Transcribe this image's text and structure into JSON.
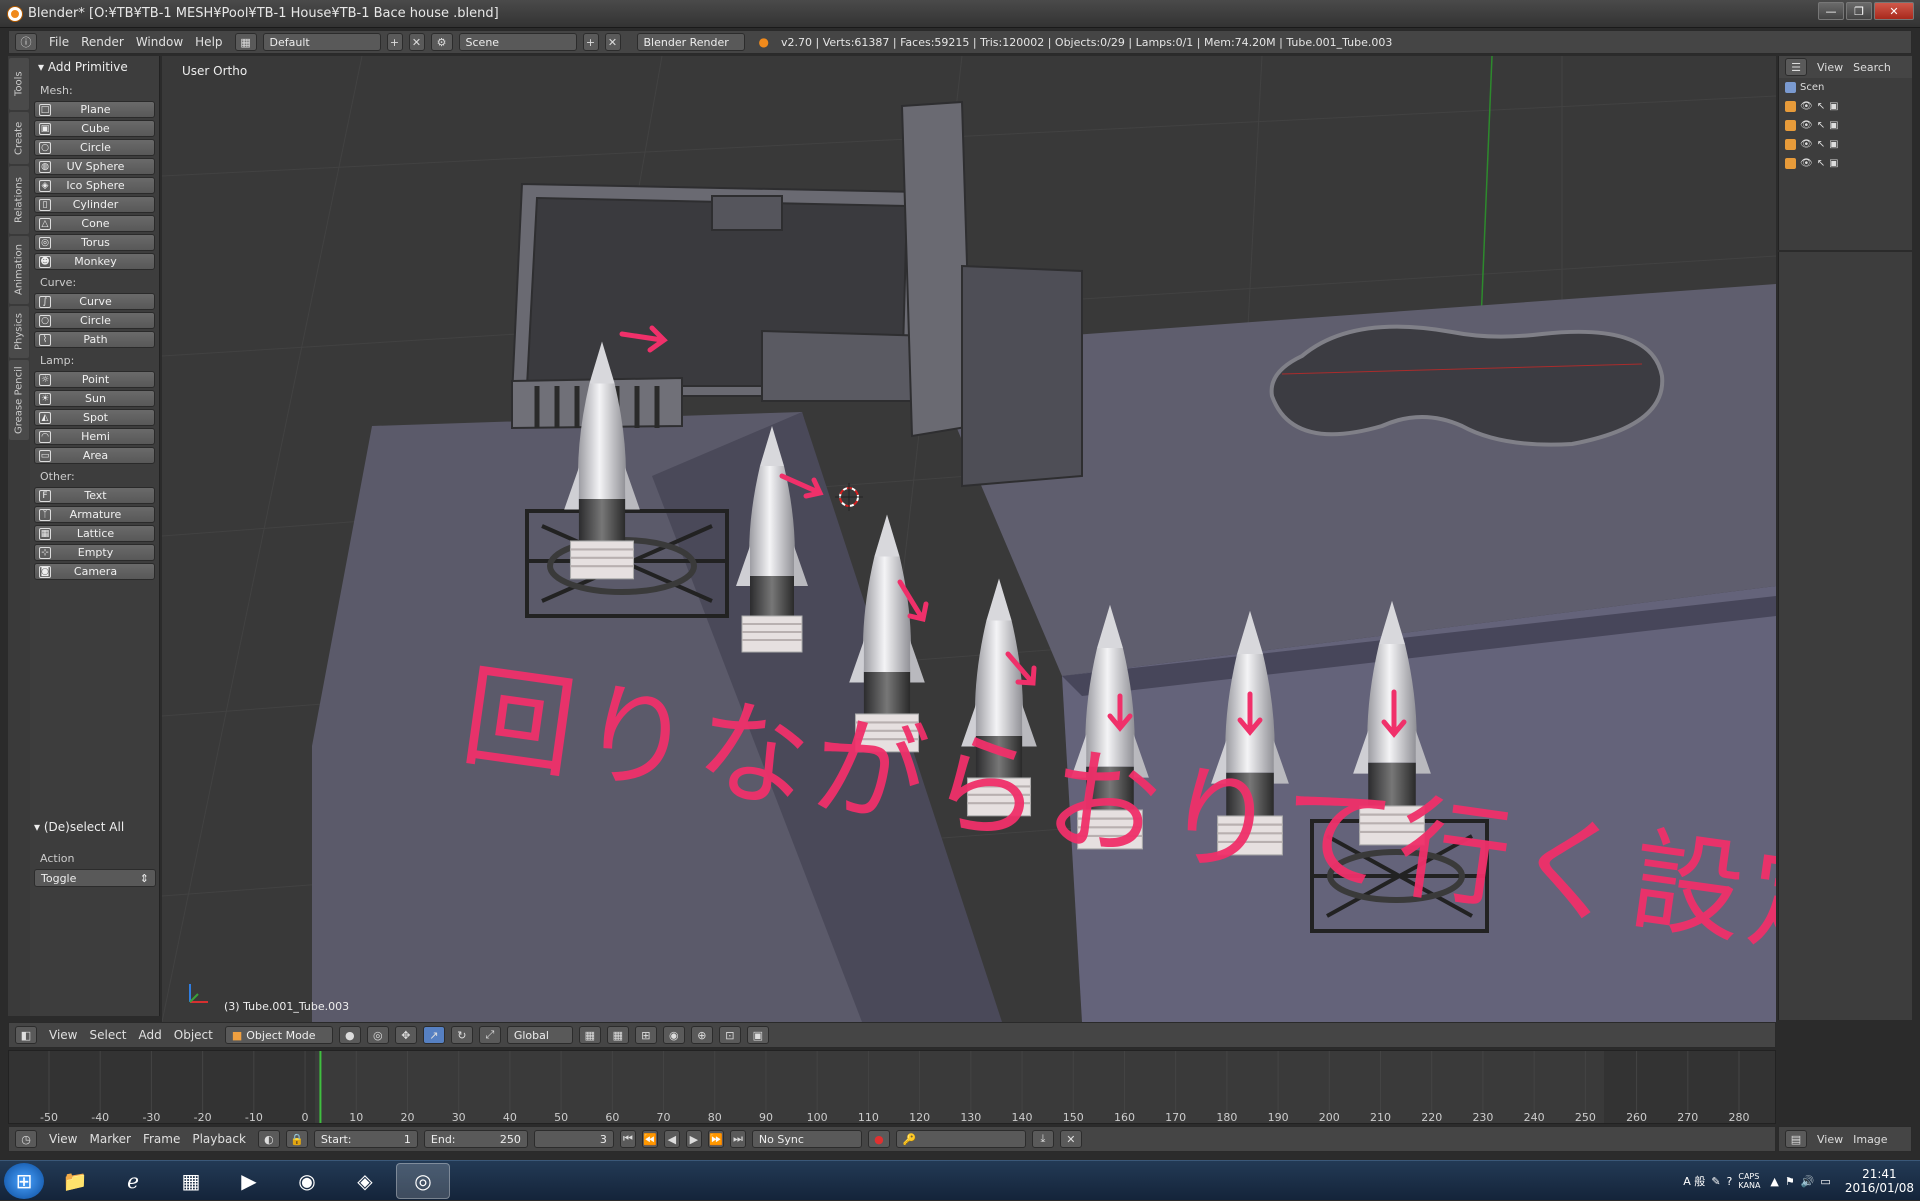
{
  "window": {
    "title": "Blender* [O:¥TB¥TB-1 MESH¥Pool¥TB-1 House¥TB-1 Bace house .blend]"
  },
  "infobar": {
    "menus": [
      "File",
      "Render",
      "Window",
      "Help"
    ],
    "layout": "Default",
    "scene": "Scene",
    "engine": "Blender Render",
    "stats": "v2.70 | Verts:61387 | Faces:59215 | Tris:120002 | Objects:0/29 | Lamps:0/1 | Mem:74.20M | Tube.001_Tube.003"
  },
  "tool_tabs": [
    "Tools",
    "Create",
    "Relations",
    "Animation",
    "Physics",
    "Grease Pencil"
  ],
  "toolshelf": {
    "panel_title": "Add Primitive",
    "groups": [
      {
        "label": "Mesh:",
        "items": [
          "Plane",
          "Cube",
          "Circle",
          "UV Sphere",
          "Ico Sphere",
          "Cylinder",
          "Cone",
          "Torus",
          "Monkey"
        ]
      },
      {
        "label": "Curve:",
        "items": [
          "Curve",
          "Circle",
          "Path"
        ]
      },
      {
        "label": "Lamp:",
        "items": [
          "Point",
          "Sun",
          "Spot",
          "Hemi",
          "Area"
        ]
      },
      {
        "label": "Other:",
        "items": [
          "Text",
          "Armature",
          "Lattice",
          "Empty",
          "Camera"
        ]
      }
    ],
    "operator": {
      "title": "(De)select All",
      "label": "Action",
      "value": "Toggle"
    }
  },
  "viewport": {
    "view_name": "User Ortho",
    "object_info": "(3) Tube.001_Tube.003",
    "annotation": "回りながらおりて行く設定",
    "annotation_color": "#f0306a"
  },
  "viewport_header": {
    "menus": [
      "View",
      "Select",
      "Add",
      "Object"
    ],
    "mode": "Object Mode",
    "orientation": "Global"
  },
  "outliner": {
    "header": [
      "View",
      "Search"
    ],
    "root": "Scen"
  },
  "timeline": {
    "ticks": [
      -50,
      -40,
      -30,
      -20,
      -10,
      0,
      10,
      20,
      30,
      40,
      50,
      60,
      70,
      80,
      90,
      100,
      110,
      120,
      130,
      140,
      150,
      160,
      170,
      180,
      190,
      200,
      210,
      220,
      230,
      240,
      250,
      260,
      270,
      280
    ],
    "current_frame": 3,
    "start": 1,
    "end": 250
  },
  "timeline_header": {
    "menus": [
      "View",
      "Marker",
      "Frame",
      "Playback"
    ],
    "start_label": "Start:",
    "start_value": "1",
    "end_label": "End:",
    "end_value": "250",
    "frame_value": "3",
    "sync": "No Sync"
  },
  "image_header": {
    "menus": [
      "View",
      "Image"
    ]
  },
  "taskbar": {
    "time": "21:41",
    "date": "2016/01/08",
    "ime": "A 般",
    "caps": "CAPS KANA"
  }
}
